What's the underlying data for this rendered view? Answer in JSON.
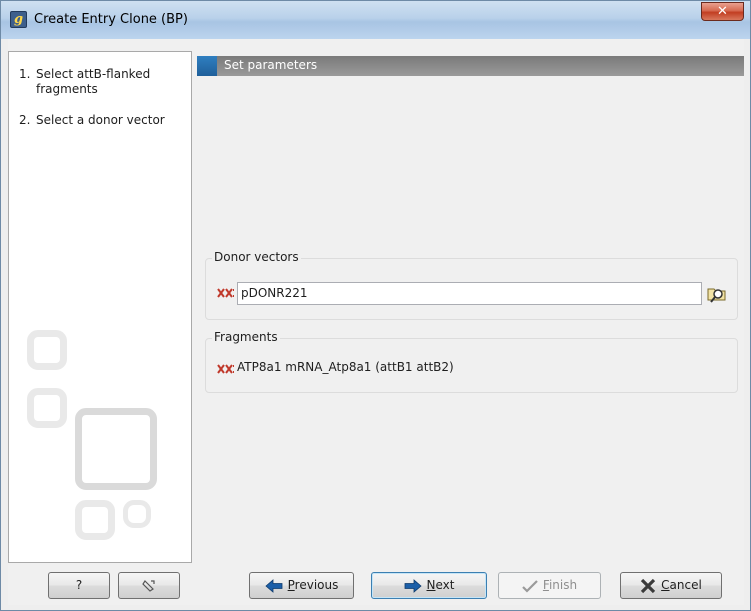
{
  "window": {
    "title": "Create Entry Clone (BP)",
    "app_icon_glyph": "g",
    "close_glyph": "✕"
  },
  "steps": [
    {
      "number": "1.",
      "label": "Select attB-flanked fragments"
    },
    {
      "number": "2.",
      "label": "Select a donor vector"
    }
  ],
  "section": {
    "title": "Set parameters"
  },
  "donor_vectors": {
    "group_title": "Donor vectors",
    "value": "pDONR221",
    "icon": "sequence-icon",
    "browse_icon": "folder-search-icon"
  },
  "fragments": {
    "group_title": "Fragments",
    "items": [
      "ATP8a1 mRNA_Atp8a1 (attB1 attB2)"
    ],
    "icon": "sequence-icon"
  },
  "buttons": {
    "help": "?",
    "reset_icon": "reset-icon",
    "previous": {
      "mnemonic": "P",
      "rest": "revious"
    },
    "next": {
      "mnemonic": "N",
      "rest": "ext"
    },
    "finish": {
      "mnemonic": "F",
      "rest": "inish"
    },
    "cancel": {
      "mnemonic": "C",
      "rest": "ancel"
    }
  },
  "colors": {
    "titlebar": "#b9d1ea",
    "close_button": "#c94a2e",
    "section_header": "#8a8a8a",
    "section_accent": "#2a6fb0",
    "sequence_icon": "#c0392b"
  }
}
